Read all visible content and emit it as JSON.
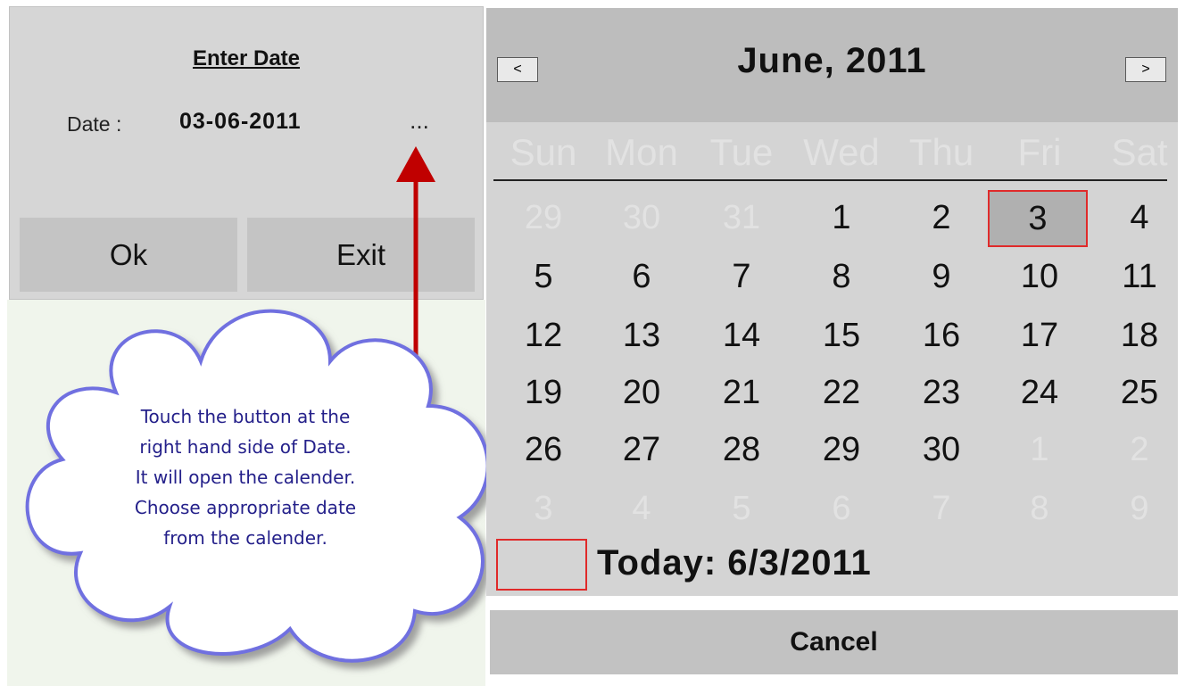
{
  "entry_dialog": {
    "title": "Enter Date",
    "date_label": "Date :",
    "date_value": "03-06-2011",
    "picker_button": "...",
    "ok_label": "Ok",
    "exit_label": "Exit"
  },
  "callout": {
    "lines": [
      "Touch the button at the",
      "right hand side of Date.",
      "It will open the calender.",
      "Choose appropriate date",
      "from the calender."
    ]
  },
  "calendar": {
    "prev_icon": "<",
    "next_icon": ">",
    "month_title": "June, 2011",
    "weekdays": [
      "Sun",
      "Mon",
      "Tue",
      "Wed",
      "Thu",
      "Fri",
      "Sat"
    ],
    "weeks": [
      [
        "29",
        "30",
        "31",
        "1",
        "2",
        "3",
        "4"
      ],
      [
        "5",
        "6",
        "7",
        "8",
        "9",
        "10",
        "11"
      ],
      [
        "12",
        "13",
        "14",
        "15",
        "16",
        "17",
        "18"
      ],
      [
        "19",
        "20",
        "21",
        "22",
        "23",
        "24",
        "25"
      ],
      [
        "26",
        "27",
        "28",
        "29",
        "30",
        "1",
        "2"
      ],
      [
        "3",
        "4",
        "5",
        "6",
        "7",
        "8",
        "9"
      ]
    ],
    "selected_day": "3",
    "today_label": "Today: 6/3/2011",
    "cancel_label": "Cancel"
  },
  "colors": {
    "callout_text": "#24208a",
    "arrow": "#c00000",
    "highlight_border": "#e02a2a"
  }
}
